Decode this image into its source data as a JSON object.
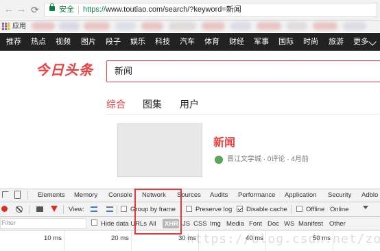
{
  "browser": {
    "nav_back": "←",
    "nav_forward": "→",
    "reload": "C",
    "security_label": "安全",
    "url_proto": "https://",
    "url_rest": "www.toutiao.com/search/?keyword=新闻",
    "bookmarks_apps_label": "应用"
  },
  "site": {
    "nav_items": [
      "推荐",
      "热点",
      "视频",
      "图片",
      "段子",
      "娱乐",
      "科技",
      "汽车",
      "体育",
      "财经",
      "军事",
      "国际",
      "时尚",
      "旅游",
      "更多"
    ],
    "logo": "今日头条",
    "search_value": "新闻",
    "tabs": [
      "综合",
      "图集",
      "用户"
    ],
    "active_tab": "综合",
    "result": {
      "title": "新闻",
      "source": "晋江文学城",
      "comments": "0评论",
      "age": "4月前",
      "meta_sep": " · "
    },
    "colors": {
      "accent": "#ed4040",
      "nav_bg": "#222222"
    }
  },
  "devtools": {
    "tabs": [
      "Elements",
      "Memory",
      "Console",
      "Network",
      "Sources",
      "Audits",
      "Performance",
      "Application",
      "Security",
      "Adblo"
    ],
    "active_tab": "Network",
    "toolbar": {
      "view_label": "View:",
      "group_by_frame": "Group by frame",
      "preserve_log": "Preserve log",
      "disable_cache": "Disable cache",
      "offline": "Offline",
      "throttle": "Online"
    },
    "checkboxes": {
      "group_by_frame": false,
      "preserve_log": false,
      "disable_cache": true,
      "offline": false
    },
    "filter": {
      "placeholder": "Filter",
      "hide_data_urls": "Hide data URLs",
      "types": [
        "All",
        "XHR",
        "JS",
        "CSS",
        "Img",
        "Media",
        "Font",
        "Doc",
        "WS",
        "Manifest",
        "Other"
      ],
      "selected_type": "XHR"
    },
    "timeline_ticks": [
      "10 ms",
      "20 ms",
      "30 ms",
      "40 ms",
      "50 ms"
    ]
  },
  "watermark": "https://blog.csdn.net/zorlan"
}
